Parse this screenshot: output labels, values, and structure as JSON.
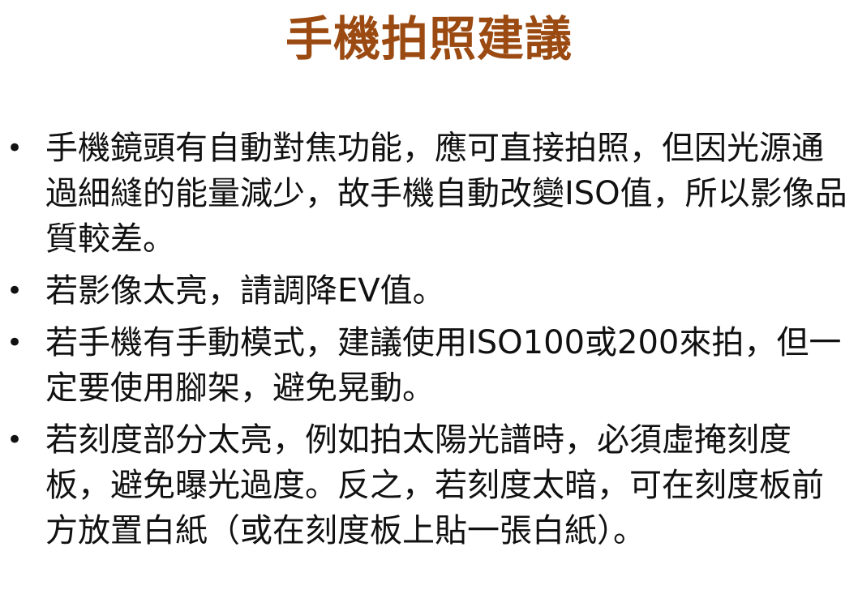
{
  "title": "手機拍照建議",
  "bullets": [
    {
      "marker": "•",
      "text": "手機鏡頭有自動對焦功能，應可直接拍照，但因光源通過細縫的能量減少，故手機自動改變ISO值，所以影像品質較差。"
    },
    {
      "marker": "•",
      "text": "若影像太亮，請調降EV值。"
    },
    {
      "marker": "•",
      "text": "若手機有手動模式，建議使用ISO100或200來拍，但一定要使用腳架，避免晃動。"
    },
    {
      "marker": "•",
      "text": "若刻度部分太亮，例如拍太陽光譜時，必須虛掩刻度板，避免曝光過度。反之，若刻度太暗，可在刻度板前方放置白紙（或在刻度板上貼一張白紙）。"
    }
  ],
  "colors": {
    "title": "#9b4a12",
    "text": "#111111",
    "background": "#ffffff"
  }
}
